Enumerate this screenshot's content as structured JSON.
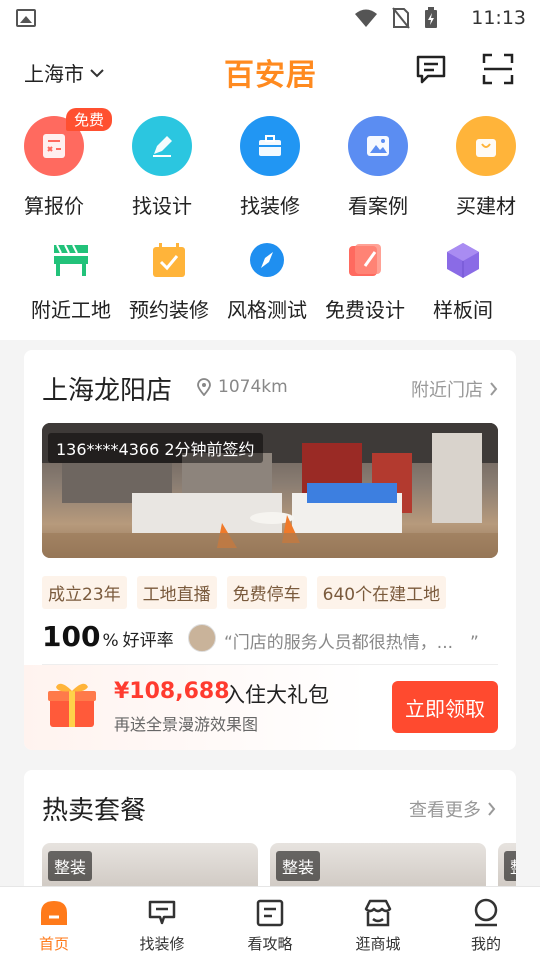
{
  "status": {
    "time": "11:13"
  },
  "header": {
    "city": "上海市",
    "brand": "百安居"
  },
  "quick_actions": [
    {
      "label": "算报价",
      "badge": "免费",
      "icon": "calculator-icon",
      "color": "#ff6a5f"
    },
    {
      "label": "找设计",
      "icon": "pen-icon",
      "color": "#2bc6e0"
    },
    {
      "label": "找装修",
      "icon": "toolbox-icon",
      "color": "#2196f3"
    },
    {
      "label": "看案例",
      "icon": "image-icon",
      "color": "#5b8df2"
    },
    {
      "label": "买建材",
      "icon": "shopping-bag-icon",
      "color": "#ffb43a"
    }
  ],
  "secondary_actions": [
    {
      "label": "附近工地",
      "icon": "construction-site-icon"
    },
    {
      "label": "预约装修",
      "icon": "calendar-check-icon"
    },
    {
      "label": "风格测试",
      "icon": "compass-icon"
    },
    {
      "label": "免费设计",
      "icon": "design-card-icon"
    },
    {
      "label": "样板间",
      "icon": "cube-icon"
    }
  ],
  "store": {
    "name": "上海龙阳店",
    "distance": "1074km",
    "nearby_label": "附近门店",
    "photo_caption": "136****4366  2分钟前签约",
    "tags": [
      "成立23年",
      "工地直播",
      "免费停车",
      "640个在建工地"
    ],
    "rating_value": "100",
    "rating_pct": "%",
    "rating_label": "好评率",
    "review": "“门店的服务人员都很热情，...　”"
  },
  "promo": {
    "price": "¥108,688",
    "title": "入住大礼包",
    "subtitle": "再送全景漫游效果图",
    "button": "立即领取"
  },
  "hot": {
    "title": "热卖套餐",
    "see_more": "查看更多",
    "packages": [
      {
        "tag": "整装"
      },
      {
        "tag": "整装"
      },
      {
        "tag": "整"
      }
    ]
  },
  "tabs": [
    {
      "label": "首页",
      "icon": "home-icon",
      "active": true
    },
    {
      "label": "找装修",
      "icon": "decor-icon"
    },
    {
      "label": "看攻略",
      "icon": "guide-icon"
    },
    {
      "label": "逛商城",
      "icon": "store-icon"
    },
    {
      "label": "我的",
      "icon": "profile-icon"
    }
  ],
  "colors": {
    "brand": "#ff8a1f",
    "accent": "#ff4a2f"
  }
}
